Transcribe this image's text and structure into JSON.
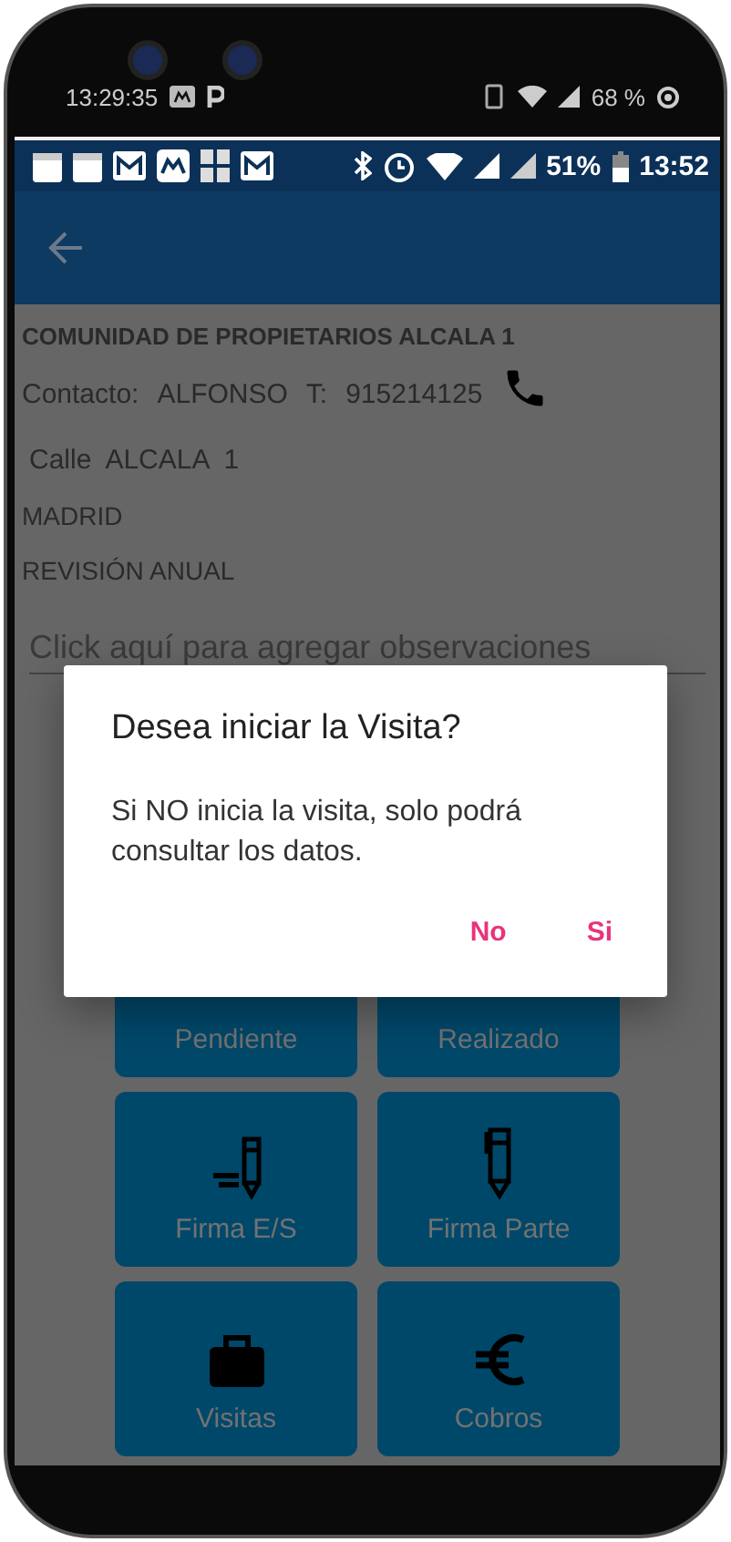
{
  "device_status": {
    "time": "13:29:35",
    "battery": "68 %"
  },
  "status_bar": {
    "battery": "51%",
    "time": "13:52"
  },
  "details": {
    "title": "COMUNIDAD DE PROPIETARIOS ALCALA 1",
    "contact_label": "Contacto:",
    "contact_name": "ALFONSO",
    "phone_label": "T:",
    "phone": "915214125",
    "address": "Calle  ALCALA  1",
    "city": "MADRID",
    "service": "REVISIÓN ANUAL"
  },
  "notes": {
    "placeholder": "Click aquí para agregar observaciones"
  },
  "tiles": [
    {
      "label": "Pendiente"
    },
    {
      "label": "Realizado"
    },
    {
      "label": "Firma E/S"
    },
    {
      "label": "Firma Parte"
    },
    {
      "label": "Visitas"
    },
    {
      "label": "Cobros"
    }
  ],
  "dialog": {
    "title": "Desea iniciar la Visita?",
    "message": "Si NO inicia la visita, solo podrá consultar los datos.",
    "buttons": [
      "No",
      "Si"
    ]
  }
}
